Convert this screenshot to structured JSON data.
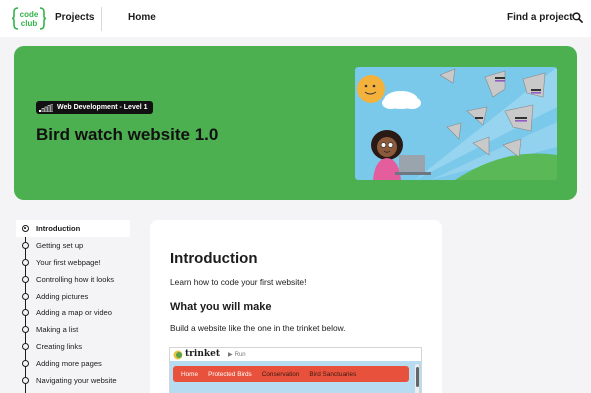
{
  "header": {
    "logo_line1": "code",
    "logo_line2": "club",
    "projects": "Projects",
    "home": "Home",
    "find_project": "Find a project"
  },
  "hero": {
    "badge": "Web Development - Level 1",
    "title": "Bird watch website 1.0",
    "background_color": "#4caf50"
  },
  "steps": [
    "Introduction",
    "Getting set up",
    "Your first webpage!",
    "Controlling how it looks",
    "Adding pictures",
    "Adding a map or video",
    "Making a list",
    "Creating links",
    "Adding more pages",
    "Navigating your website"
  ],
  "active_step": 0,
  "content": {
    "heading": "Introduction",
    "intro": "Learn how to code your first website!",
    "subheading": "What you will make",
    "body": "Build a website like the one in the trinket below."
  },
  "trinket": {
    "name": "trinket",
    "run_label": "Run",
    "nav_items": [
      "Home",
      "Protected Birds",
      "Conservation",
      "Bird Sanctuaries"
    ],
    "nav_color": "#e8523c",
    "viewport_color": "#b7dcf1"
  }
}
